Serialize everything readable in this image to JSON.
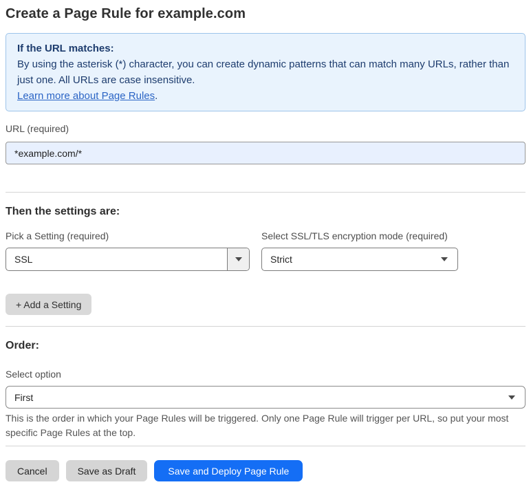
{
  "page": {
    "title": "Create a Page Rule for example.com"
  },
  "info_box": {
    "heading": "If the URL matches:",
    "body": "By using the asterisk (*) character, you can create dynamic patterns that can match many URLs, rather than just one. All URLs are case insensitive.",
    "link_label": "Learn more about Page Rules",
    "link_suffix": "."
  },
  "url_field": {
    "label": "URL (required)",
    "value": "*example.com/*"
  },
  "settings_section": {
    "heading": "Then the settings are:",
    "pick_setting": {
      "label": "Pick a Setting (required)",
      "value": "SSL"
    },
    "encryption_mode": {
      "label": "Select SSL/TLS encryption mode (required)",
      "value": "Strict"
    },
    "add_setting_label": "+ Add a Setting"
  },
  "order_section": {
    "heading": "Order:",
    "select_label": "Select option",
    "value": "First",
    "help_text": "This is the order in which your Page Rules will be triggered. Only one Page Rule will trigger per URL, so put your most specific Page Rules at the top."
  },
  "footer": {
    "cancel_label": "Cancel",
    "save_draft_label": "Save as Draft",
    "save_deploy_label": "Save and Deploy Page Rule"
  },
  "colors": {
    "info_background": "#e9f3fd",
    "info_border": "#9dc4ea",
    "info_text": "#1d3c6e",
    "link_blue": "#2a64c5",
    "input_autofill_background": "#e8f0fe",
    "primary_button_blue": "#146ef5",
    "secondary_button_gray": "#d5d5d5"
  }
}
